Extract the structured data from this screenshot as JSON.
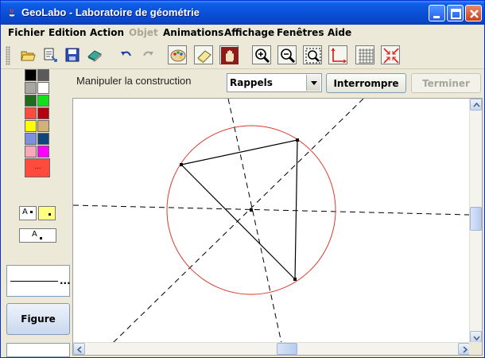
{
  "window": {
    "title": "GeoLabo - Laboratoire de géométrie"
  },
  "menu": [
    {
      "label": "Fichier",
      "enabled": true
    },
    {
      "label": "Edition",
      "enabled": true
    },
    {
      "label": "Action",
      "enabled": true
    },
    {
      "label": "Objet",
      "enabled": false
    },
    {
      "label": "Animations",
      "enabled": true
    },
    {
      "label": "Affichage",
      "enabled": true
    },
    {
      "label": "Fenêtres",
      "enabled": true
    },
    {
      "label": "Aide",
      "enabled": true
    }
  ],
  "toolbar": {
    "icons": [
      "open-folder-icon",
      "import-icon",
      "save-icon",
      "book-icon",
      "undo-icon",
      "redo-icon",
      "palette-icon",
      "eraser-icon",
      "hand-icon",
      "zoom-in-icon",
      "zoom-out-icon",
      "zoom-fit-icon",
      "axes-icon",
      "grid-icon",
      "compress-icon"
    ]
  },
  "palette": {
    "colors": [
      "#000000",
      "#5a5a5a",
      "#a8a8a0",
      "#ffffff",
      "#1f6b1f",
      "#12e01a",
      "#ff4a3e",
      "#b5000d",
      "#ffff00",
      "#d2b07a",
      "#7d8fe0",
      "#12457a",
      "#f8a8b8",
      "#ff00ff"
    ],
    "current_color": "#ff4a3e",
    "current_label": "...",
    "point_style_label_1": "A",
    "point_style_label_2": "A",
    "point_style_label_3": "A",
    "line_style_more": "..."
  },
  "figure_button": "Figure",
  "action_bar": {
    "mode_label": "Manipuler la construction",
    "combo_value": "Rappels",
    "interrupt_label": "Interrompre",
    "finish_label": "Terminer"
  },
  "colors": {
    "circle": "#d93a2c",
    "lines": "#000000"
  }
}
